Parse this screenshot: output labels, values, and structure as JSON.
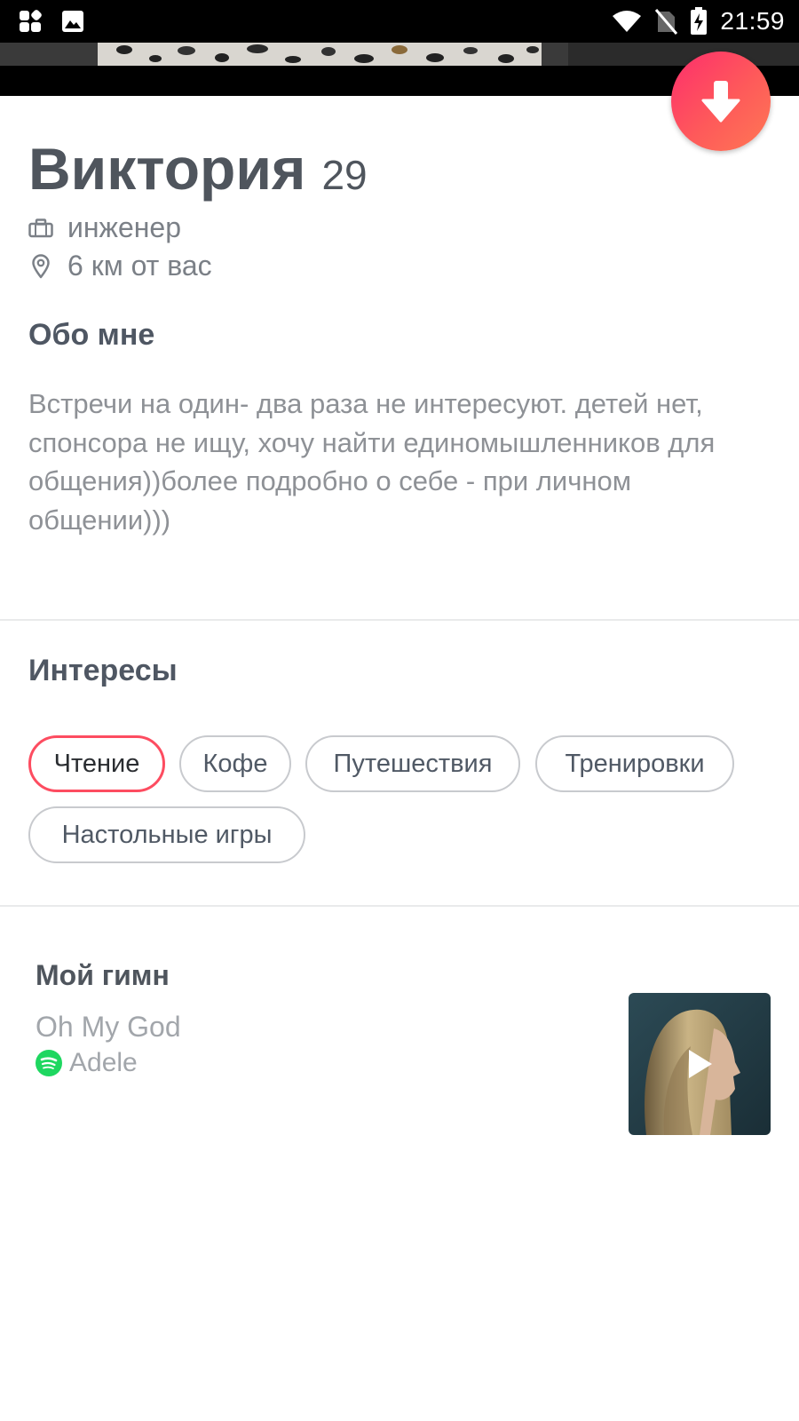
{
  "status_bar": {
    "time": "21:59"
  },
  "profile": {
    "name": "Виктория",
    "age": "29",
    "job": "инженер",
    "distance": "6 км от вас"
  },
  "about": {
    "title": "Обо мне",
    "text": " Встречи на один- два раза не интересуют. детей нет, спонсора не ищу, хочу найти единомышленников для общения))более подробно о себе - при личном общении)))"
  },
  "interests": {
    "title": "Интересы",
    "items": [
      "Чтение",
      "Кофе",
      "Путешествия",
      "Тренировки",
      "Настольные игры"
    ]
  },
  "anthem": {
    "title": "Мой гимн",
    "song": "Oh My God",
    "artist": "Adele"
  },
  "colors": {
    "accent": "#fd4c60",
    "spotify": "#1ed760",
    "button_gradient_start": "#fd2e6c",
    "button_gradient_end": "#ff7854"
  },
  "icons": {
    "job": "briefcase-icon",
    "distance": "location-pin-icon",
    "collapse": "arrow-down-icon",
    "music_service": "spotify-icon",
    "play": "play-icon"
  }
}
